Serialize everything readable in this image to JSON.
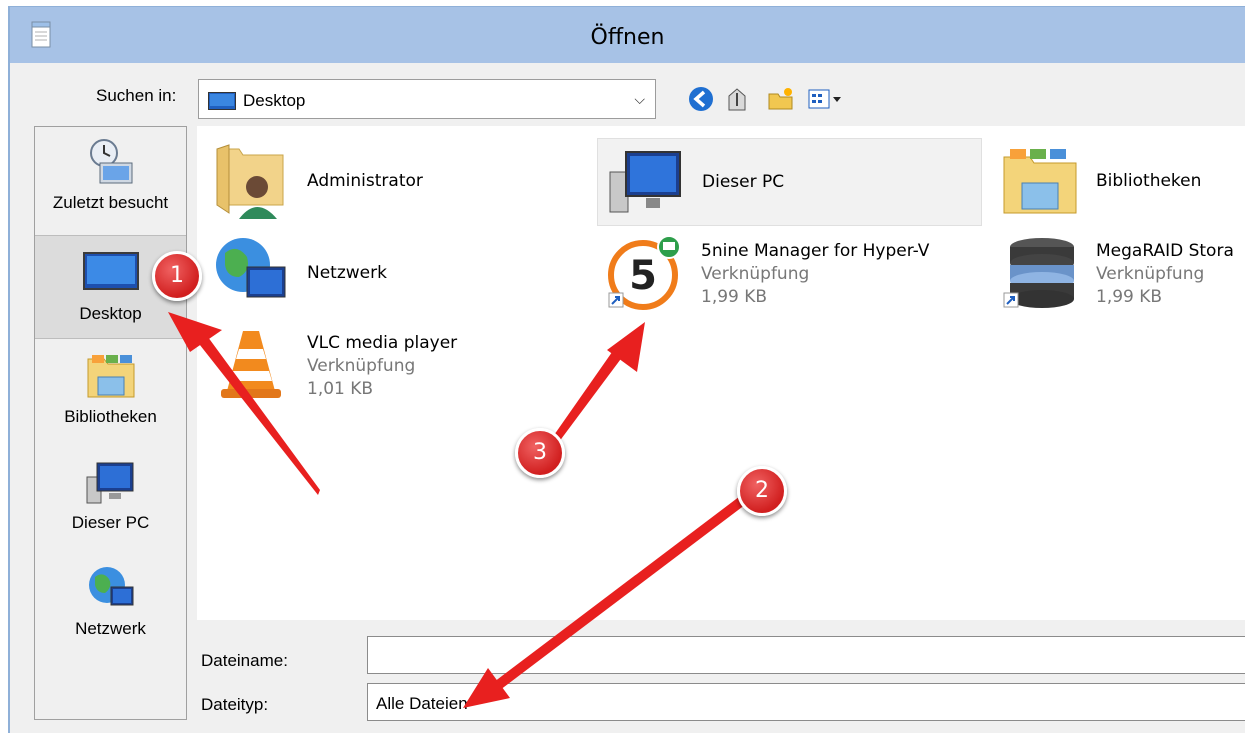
{
  "window": {
    "title": "Öffnen",
    "icon": "notepad-icon"
  },
  "toolbar": {
    "lookin_label": "Suchen in:",
    "lookin_value": "Desktop",
    "buttons": [
      "back-icon",
      "up-folder-icon",
      "new-folder-icon",
      "view-menu-icon"
    ]
  },
  "places": [
    {
      "label": "Zuletzt besucht",
      "icon": "recent-places-icon"
    },
    {
      "label": "Desktop",
      "icon": "desktop-icon",
      "selected": true
    },
    {
      "label": "Bibliotheken",
      "icon": "libraries-icon"
    },
    {
      "label": "Dieser PC",
      "icon": "computer-icon"
    },
    {
      "label": "Netzwerk",
      "icon": "network-icon"
    }
  ],
  "files": [
    {
      "name": "Administrator",
      "icon": "user-folder-icon"
    },
    {
      "name": "Dieser PC",
      "icon": "computer-icon",
      "hover": true
    },
    {
      "name": "Bibliotheken",
      "icon": "libraries-icon"
    },
    {
      "name": "Netzwerk",
      "icon": "network-icon"
    },
    {
      "name": "5nine Manager for Hyper-V",
      "type": "Verknüpfung",
      "size": "1,99 KB",
      "icon": "5nine-manager-shortcut-icon"
    },
    {
      "name": "MegaRAID Stora",
      "type": "Verknüpfung",
      "size": "1,99 KB",
      "icon": "megaraid-shortcut-icon"
    },
    {
      "name": "VLC media player",
      "type": "Verknüpfung",
      "size": "1,01 KB",
      "icon": "vlc-cone-icon"
    }
  ],
  "bottom": {
    "filename_label": "Dateiname:",
    "filename_value": "",
    "filetype_label": "Dateityp:",
    "filetype_value": "Alle Dateien"
  },
  "annotations": {
    "badges": [
      "1",
      "2",
      "3"
    ],
    "color": "#e8201f"
  },
  "colors": {
    "titlebar": "#a7c2e6",
    "dialog_bg": "#f0f0f0",
    "badge_red": "#d11f1f"
  }
}
